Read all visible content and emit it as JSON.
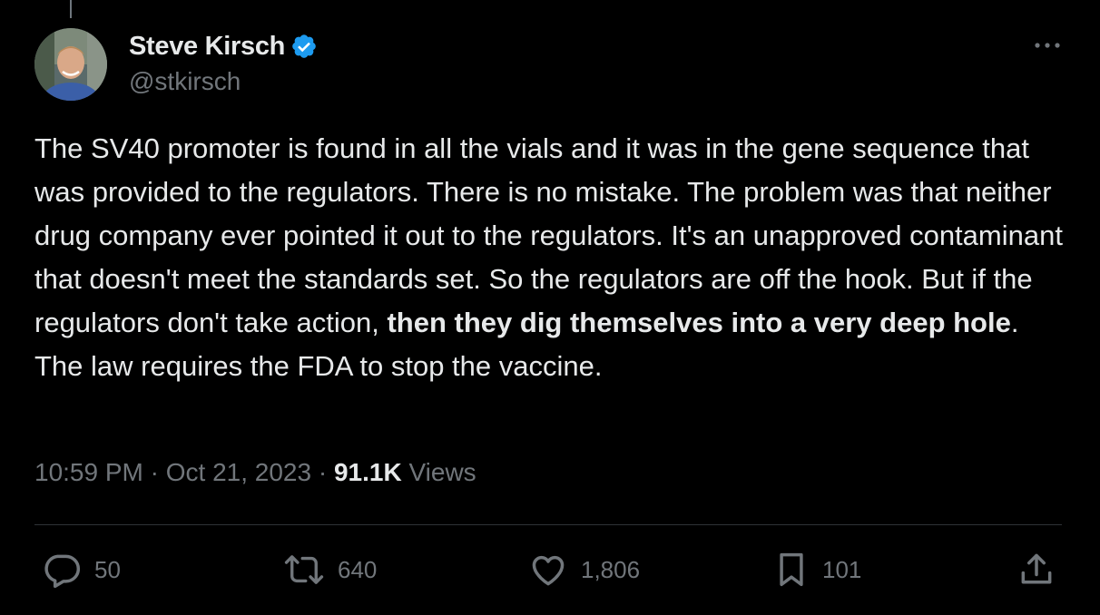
{
  "author": {
    "display_name": "Steve Kirsch",
    "handle": "@stkirsch",
    "verified": true,
    "verified_badge_color": "#1d9bf0"
  },
  "tweet": {
    "text_part1": "The SV40 promoter is found in all the vials and it was in the gene sequence that was provided to the regulators. There is no mistake. The problem was that neither drug company ever pointed it out to the regulators. It's an unapproved contaminant that doesn't meet the standards set. So the regulators are off the hook. But if the regulators don't take action, ",
    "text_bold": "then they dig themselves into a very deep hole",
    "text_part2": ". The law requires the FDA to stop the vaccine."
  },
  "meta": {
    "time": "10:59 PM",
    "separator": "·",
    "date": "Oct 21, 2023",
    "views_count": "91.1K",
    "views_label": "Views"
  },
  "actions": {
    "replies": "50",
    "reposts": "640",
    "likes": "1,806",
    "bookmarks": "101"
  },
  "icons": {
    "reply": "reply-icon",
    "repost": "repost-icon",
    "like": "heart-icon",
    "bookmark": "bookmark-icon",
    "share": "share-icon",
    "more": "more-icon",
    "verified": "verified-badge-icon"
  },
  "colors": {
    "background": "#000000",
    "text_primary": "#e7e9ea",
    "text_secondary": "#71767b",
    "divider": "#2f3336"
  }
}
